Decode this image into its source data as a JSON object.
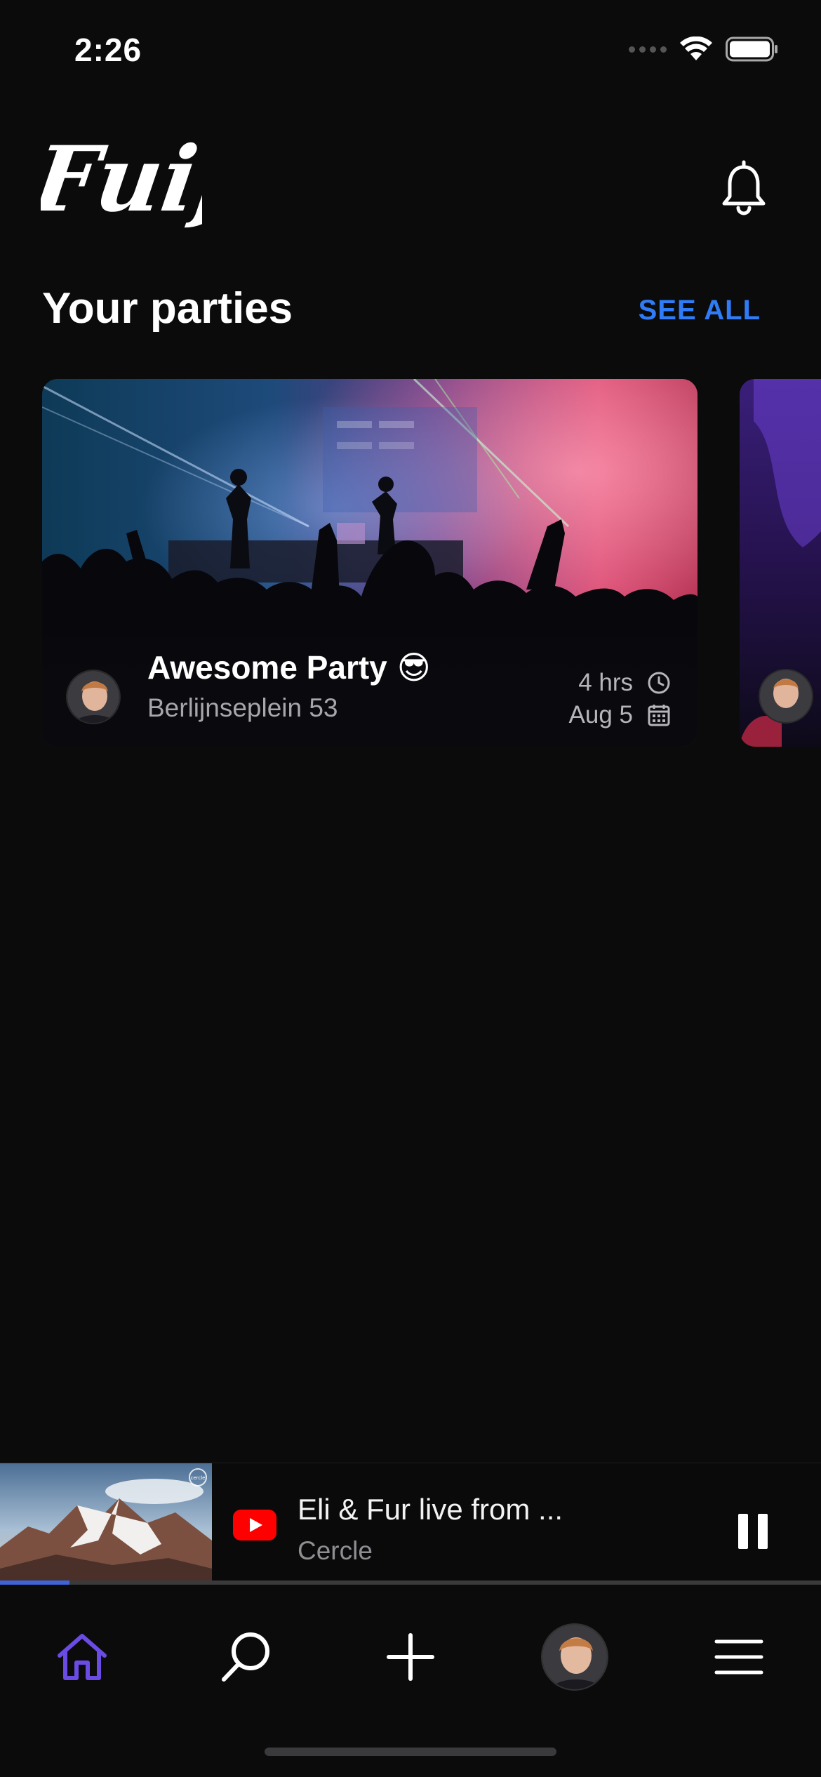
{
  "status_bar": {
    "time": "2:26"
  },
  "header": {
    "logo_text": "Fuif"
  },
  "section": {
    "title": "Your parties",
    "see_all_label": "SEE ALL"
  },
  "parties": [
    {
      "title": "Awesome Party",
      "emoji": "😎",
      "location": "Berlijnseplein 53",
      "duration": "4 hrs",
      "date": "Aug 5"
    }
  ],
  "player": {
    "title": "Eli & Fur live from ...",
    "subtitle": "Cercle",
    "thumbnail_badge": "cercle",
    "progress": 0.085
  },
  "tabs": [
    {
      "name": "home",
      "icon": "home-icon",
      "active": true
    },
    {
      "name": "search",
      "icon": "search-icon",
      "active": false
    },
    {
      "name": "create",
      "icon": "plus-icon",
      "active": false
    },
    {
      "name": "profile",
      "icon": "avatar",
      "active": false
    },
    {
      "name": "menu",
      "icon": "menu-icon",
      "active": false
    }
  ],
  "colors": {
    "background": "#0b0b0c",
    "accent_link": "#2f7cf6",
    "active_tab": "#6a4be3",
    "youtube_red": "#ff0000"
  }
}
